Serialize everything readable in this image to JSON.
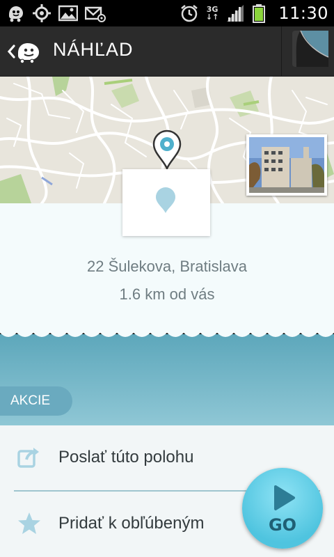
{
  "status_bar": {
    "time": "11:30",
    "network": "3G",
    "left_icons": [
      "waze-icon",
      "gps-icon",
      "picture-icon",
      "email-icon"
    ],
    "right_icons": [
      "alarm-icon",
      "signal-icon",
      "battery-icon"
    ]
  },
  "action_bar": {
    "title": "NÁHĽAD"
  },
  "place": {
    "address_line1": "22 Šulekova, Bratislava",
    "address_line2": "1.6 km od vás"
  },
  "actions": {
    "section_label": "AKCIE",
    "items": [
      {
        "label": "Poslať túto polohu",
        "icon": "share-icon"
      },
      {
        "label": "Pridať k obľúbeným",
        "icon": "star-icon"
      }
    ],
    "go_label": "GO"
  },
  "colors": {
    "accent": "#4fc4df",
    "band": "#6aaabf",
    "panel": "#f4fbfc"
  }
}
